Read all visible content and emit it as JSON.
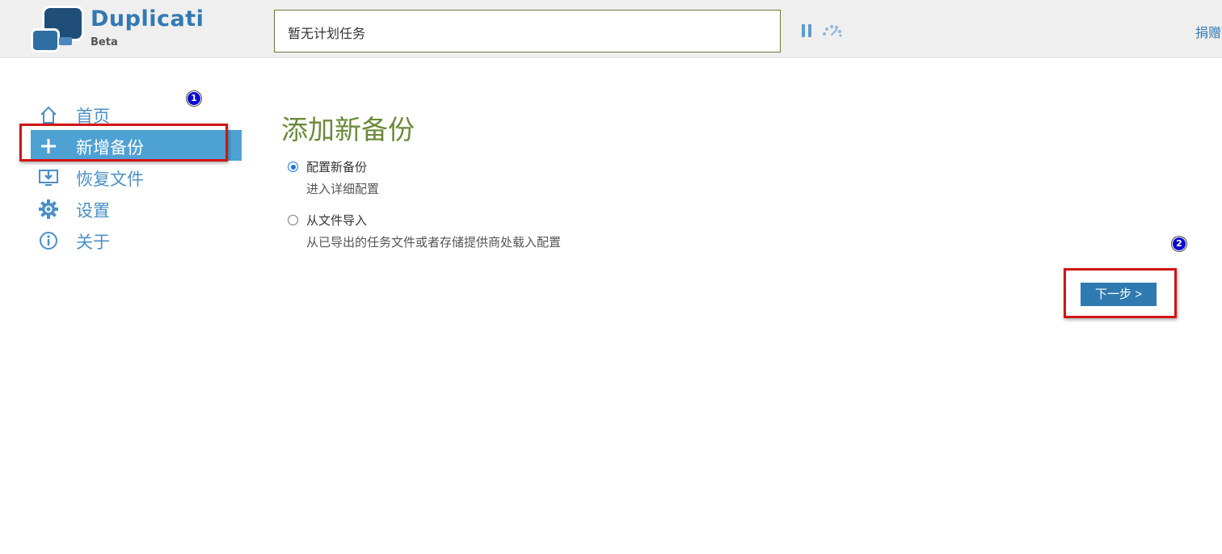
{
  "header": {
    "app_title": "Duplicati",
    "app_subtitle": "Beta",
    "status_text": "暂无计划任务",
    "pause_icon": "pause-icon",
    "throttle_icon": "speedometer-icon",
    "donate_label": "捐赠"
  },
  "sidebar": {
    "items": [
      {
        "label": "首页",
        "icon": "home-icon",
        "active": false
      },
      {
        "label": "新增备份",
        "icon": "plus-icon",
        "active": true
      },
      {
        "label": "恢复文件",
        "icon": "restore-icon",
        "active": false
      },
      {
        "label": "设置",
        "icon": "gear-icon",
        "active": false
      },
      {
        "label": "关于",
        "icon": "info-icon",
        "active": false
      }
    ]
  },
  "main": {
    "title": "添加新备份",
    "options": [
      {
        "label": "配置新备份",
        "description": "进入详细配置",
        "selected": true
      },
      {
        "label": "从文件导入",
        "description": "从已导出的任务文件或者存储提供商处载入配置",
        "selected": false
      }
    ],
    "next_label": "下一步 >"
  },
  "annotations": {
    "badge_1": "1",
    "badge_2": "2"
  },
  "colors": {
    "accent": "#3279b4",
    "sidebar_active": "#4ea1d3",
    "title_green": "#6b8a3a",
    "highlight_red": "#d01515",
    "button_blue": "#2f7ab1"
  }
}
